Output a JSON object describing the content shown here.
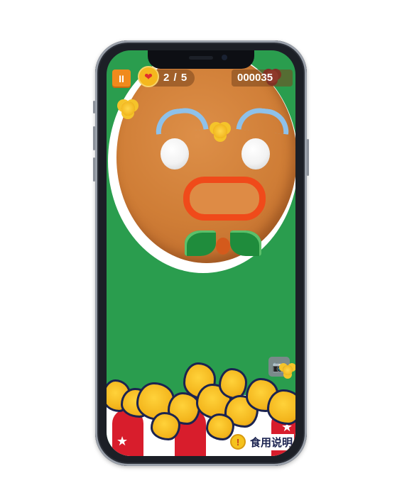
{
  "hud": {
    "pause_symbol": "II",
    "heart_symbol": "❤",
    "lives": "2 / 5",
    "score": "000035"
  },
  "controls": {
    "camera_symbol": "📷",
    "instructions_icon": "!",
    "instructions_label": "食用说明"
  },
  "colors": {
    "background_green": "#2a9d4e",
    "cookie": "#cf7d36",
    "mouth": "#f04a1a",
    "brow": "#8ec1ea",
    "bow": "#1f8c3c",
    "popcorn": "#f3b51c",
    "bucket_red": "#d81d2c",
    "pause_button": "#f08a1c"
  },
  "decor": {
    "star_symbol": "★"
  }
}
